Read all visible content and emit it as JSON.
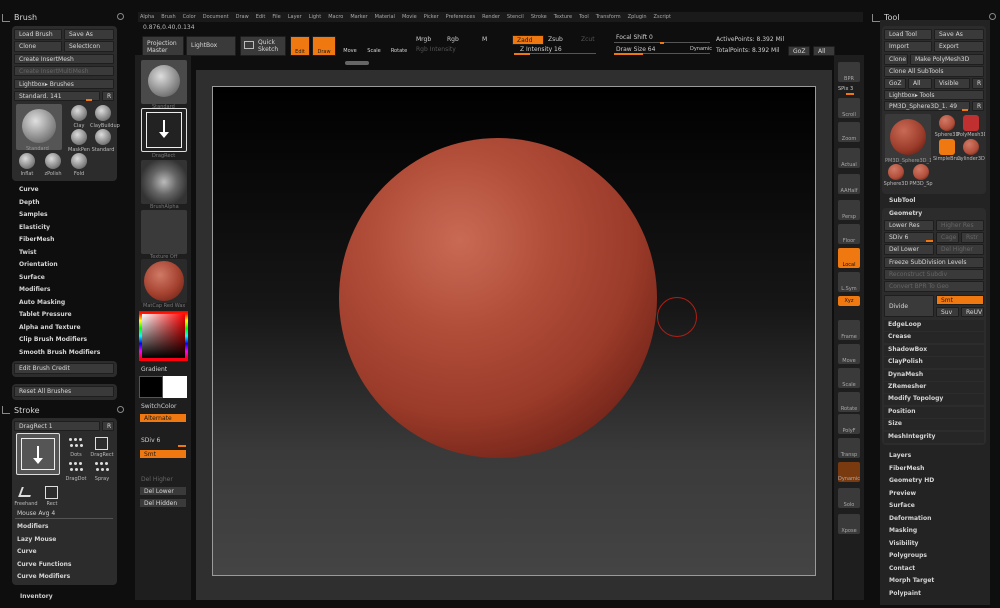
{
  "menu": [
    "Alpha",
    "Brush",
    "Color",
    "Document",
    "Draw",
    "Edit",
    "File",
    "Layer",
    "Light",
    "Macro",
    "Marker",
    "Material",
    "Movie",
    "Picker",
    "Preferences",
    "Render",
    "Stencil",
    "Stroke",
    "Texture",
    "Tool",
    "Transform",
    "Zplugin",
    "Zscript"
  ],
  "coords": "0.876,0.40,0.134",
  "brush": {
    "title": "Brush",
    "load": "Load Brush",
    "saveas": "Save As",
    "clone": "Clone",
    "selecticon": "SelectIcon",
    "create_insert": "Create InsertMesh",
    "create_insert2": "Create InsertMultiMesh",
    "lightbox": "Lightbox▸ Brushes",
    "current": "Standard. 141",
    "r": "R",
    "items": [
      {
        "n": "Standard"
      },
      {
        "n": "Clay"
      },
      {
        "n": "ClayBuildup"
      },
      {
        "n": "MaskPen"
      },
      {
        "n": "Standard"
      },
      {
        "n": "Inflat"
      },
      {
        "n": "zPolish"
      },
      {
        "n": "Fold"
      }
    ],
    "menu": [
      "Curve",
      "Depth",
      "Samples",
      "Elasticity",
      "FiberMesh",
      "Twist",
      "Orientation",
      "Surface",
      "Modifiers",
      "Auto Masking",
      "Tablet Pressure",
      "Alpha and Texture",
      "Clip Brush Modifiers",
      "Smooth Brush Modifiers"
    ],
    "edit_credit": "Edit Brush Credit",
    "reset": "Reset All Brushes"
  },
  "stroke": {
    "title": "Stroke",
    "current": "DragRect 1",
    "r": "R",
    "items": [
      "Dots",
      "DragRect",
      "DragDot",
      "Spray",
      "Freehand",
      "Rect"
    ],
    "mouse_avg": "Mouse Avg 4",
    "menu": [
      "Modifiers",
      "Lazy Mouse",
      "Curve",
      "Curve Functions",
      "Curve Modifiers"
    ],
    "inventory": "Inventory"
  },
  "shelf": {
    "standard": "Standard",
    "dragdot": "DragRect",
    "alpha": "BrushAlpha",
    "texture": "Texture Off",
    "material": "MatCap Red Wax",
    "gradient": "Gradient",
    "switchcolor": "SwitchColor",
    "alternate": "Alternate",
    "sdiv": "SDiv 6",
    "smt": "Smt",
    "del_higher": "Del Higher",
    "del_lower": "Del Lower",
    "del_hidden": "Del Hidden"
  },
  "top": {
    "projection_master": "Projection Master",
    "lightbox": "LightBox",
    "quick_sketch": "Quick Sketch",
    "edit": "Edit",
    "draw": "Draw",
    "move": "Move",
    "scale": "Scale",
    "rotate": "Rotate",
    "mrgb": "Mrgb",
    "rgb": "Rgb",
    "m": "M",
    "rgb_intensity": "Rgb Intensity",
    "zadd": "Zadd",
    "zsub": "Zsub",
    "zcut": "Zcut",
    "z_intensity": "Z Intensity 16",
    "focal_shift": "Focal Shift 0",
    "draw_size": "Draw Size 64",
    "dynamic": "Dynamic",
    "active_points": "ActivePoints: 8.392 Mil",
    "total_points": "TotalPoints: 8.392 Mil",
    "goz": "GoZ",
    "all": "All"
  },
  "rightshelf": [
    {
      "n": "BPR"
    },
    {
      "n": "SPix 3"
    },
    {
      "n": "Scroll"
    },
    {
      "n": "Zoom"
    },
    {
      "n": "Actual"
    },
    {
      "n": "AAHalf"
    },
    {
      "n": "Persp"
    },
    {
      "n": "Floor"
    },
    {
      "n": "Local"
    },
    {
      "n": "L.Sym"
    },
    {
      "n": "Xyz"
    },
    {
      "n": "Frame"
    },
    {
      "n": "Move"
    },
    {
      "n": "Scale"
    },
    {
      "n": "Rotate"
    },
    {
      "n": "PolyF"
    },
    {
      "n": "Transp"
    },
    {
      "n": "Dynamic"
    },
    {
      "n": "Solo"
    },
    {
      "n": "Xpose"
    }
  ],
  "tool": {
    "title": "Tool",
    "load": "Load Tool",
    "saveas": "Save As",
    "import": "Import",
    "export": "Export",
    "clone": "Clone",
    "make_poly": "Make PolyMesh3D",
    "clone_all": "Clone All SubTools",
    "goz": "GoZ",
    "all": "All",
    "visible": "Visible",
    "r": "R",
    "lightbox": "Lightbox▸ Tools",
    "current": "PM3D_Sphere3D_1. 49",
    "r2": "R",
    "items": [
      "PM3D_Sphere3D_1",
      "Sphere3D",
      "PolyMesh3D",
      "SimpleBrush",
      "Cylinder3D",
      "Sphere3D",
      "PM3D_Sp"
    ],
    "subtool": "SubTool",
    "geometry": "Geometry",
    "lower_res": "Lower Res",
    "higher_res": "Higher Res",
    "sdiv": "SDiv 6",
    "cage": "Cage",
    "rstr": "Rstr",
    "del_lower": "Del Lower",
    "del_higher": "Del Higher",
    "freeze": "Freeze SubDivision Levels",
    "reconstruct": "Reconstruct Subdiv",
    "convert_bpr": "Convert BPR To Geo",
    "divide": "Divide",
    "smt": "Smt",
    "suv": "Suv",
    "reuv": "ReUV",
    "geo_menu": [
      "EdgeLoop",
      "Crease",
      "ShadowBox",
      "ClayPolish",
      "DynaMesh",
      "ZRemesher",
      "Modify Topology",
      "Position",
      "Size",
      "MeshIntegrity"
    ],
    "menu": [
      "Layers",
      "FiberMesh",
      "Geometry HD",
      "Preview",
      "Surface",
      "Deformation",
      "Masking",
      "Visibility",
      "Polygroups",
      "Contact",
      "Morph Target",
      "Polypaint"
    ]
  },
  "colors": {
    "accent": "#f07810",
    "sphere": "#a4412f",
    "panel": "#2c2c2c",
    "button": "#3a3a3a"
  }
}
